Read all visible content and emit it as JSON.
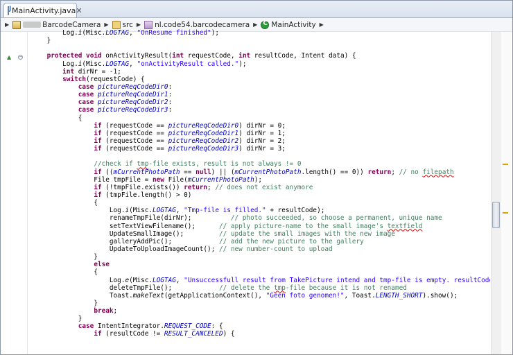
{
  "tab": {
    "title": "MainActivity.java",
    "close": "✕"
  },
  "breadcrumb": [
    {
      "label": "BarcodeCamera",
      "icon": "project-icon"
    },
    {
      "label": "src",
      "icon": "source-folder-icon"
    },
    {
      "label": "nl.code54.barcodecamera",
      "icon": "package-icon"
    },
    {
      "label": "MainActivity",
      "icon": "class-icon"
    }
  ],
  "code_lines": [
    [
      [
        "",
        "        Log."
      ],
      [
        "i",
        "i"
      ],
      [
        "",
        "(Misc."
      ],
      [
        "sf",
        "LOGTAG"
      ],
      [
        "",
        ", "
      ],
      [
        "s",
        "\"OnResume finished\""
      ],
      [
        "",
        ");"
      ]
    ],
    [
      [
        "",
        "    }"
      ]
    ],
    [
      [
        "",
        ""
      ]
    ],
    [
      [
        "",
        "    "
      ],
      [
        "k",
        "protected"
      ],
      [
        "",
        " "
      ],
      [
        "k",
        "void"
      ],
      [
        "",
        " onActivityResult("
      ],
      [
        "k",
        "int"
      ],
      [
        "",
        " requestCode, "
      ],
      [
        "k",
        "int"
      ],
      [
        "",
        " resultCode, Intent data) {"
      ]
    ],
    [
      [
        "",
        "        Log."
      ],
      [
        "i",
        "i"
      ],
      [
        "",
        "(Misc."
      ],
      [
        "sf",
        "LOGTAG"
      ],
      [
        "",
        ", "
      ],
      [
        "s",
        "\"onActivityResult called.\""
      ],
      [
        "",
        ");"
      ]
    ],
    [
      [
        "",
        "        "
      ],
      [
        "k",
        "int"
      ],
      [
        "",
        " dirNr = -1;"
      ]
    ],
    [
      [
        "",
        "        "
      ],
      [
        "k",
        "switch"
      ],
      [
        "",
        "(requestCode) {"
      ]
    ],
    [
      [
        "",
        "            "
      ],
      [
        "k",
        "case"
      ],
      [
        "",
        " "
      ],
      [
        "f",
        "pictureReqCodeDir0"
      ],
      [
        "",
        ":"
      ]
    ],
    [
      [
        "",
        "            "
      ],
      [
        "k",
        "case"
      ],
      [
        "",
        " "
      ],
      [
        "f",
        "pictureReqCodeDir1"
      ],
      [
        "",
        ":"
      ]
    ],
    [
      [
        "",
        "            "
      ],
      [
        "k",
        "case"
      ],
      [
        "",
        " "
      ],
      [
        "f",
        "pictureReqCodeDir2"
      ],
      [
        "",
        ":"
      ]
    ],
    [
      [
        "",
        "            "
      ],
      [
        "k",
        "case"
      ],
      [
        "",
        " "
      ],
      [
        "f",
        "pictureReqCodeDir3"
      ],
      [
        "",
        ":"
      ]
    ],
    [
      [
        "",
        "            {"
      ]
    ],
    [
      [
        "",
        "                "
      ],
      [
        "k",
        "if"
      ],
      [
        "",
        " (requestCode == "
      ],
      [
        "f",
        "pictureReqCodeDir0"
      ],
      [
        "",
        ") dirNr = 0;"
      ]
    ],
    [
      [
        "",
        "                "
      ],
      [
        "k",
        "if"
      ],
      [
        "",
        " (requestCode == "
      ],
      [
        "f",
        "pictureReqCodeDir1"
      ],
      [
        "",
        ") dirNr = 1;"
      ]
    ],
    [
      [
        "",
        "                "
      ],
      [
        "k",
        "if"
      ],
      [
        "",
        " (requestCode == "
      ],
      [
        "f",
        "pictureReqCodeDir2"
      ],
      [
        "",
        ") dirNr = 2;"
      ]
    ],
    [
      [
        "",
        "                "
      ],
      [
        "k",
        "if"
      ],
      [
        "",
        " (requestCode == "
      ],
      [
        "f",
        "pictureReqCodeDir3"
      ],
      [
        "",
        ") dirNr = 3;"
      ]
    ],
    [
      [
        "",
        ""
      ]
    ],
    [
      [
        "",
        "                "
      ],
      [
        "c",
        "//check if "
      ],
      [
        "cu",
        "tmp"
      ],
      [
        "c",
        "-file exists, result is not always != 0"
      ]
    ],
    [
      [
        "",
        "                "
      ],
      [
        "k",
        "if"
      ],
      [
        "",
        " (("
      ],
      [
        "f",
        "mCurrentPhotoPath"
      ],
      [
        "",
        " == "
      ],
      [
        "k",
        "null"
      ],
      [
        "",
        ") || ("
      ],
      [
        "f",
        "mCurrentPhotoPath"
      ],
      [
        "",
        ".length() == 0)) "
      ],
      [
        "k",
        "return"
      ],
      [
        "",
        "; "
      ],
      [
        "c",
        "// no "
      ],
      [
        "cu",
        "filepath"
      ]
    ],
    [
      [
        "",
        "                File tmpFile = "
      ],
      [
        "k",
        "new"
      ],
      [
        "",
        " File("
      ],
      [
        "f",
        "mCurrentPhotoPath"
      ],
      [
        "",
        ");"
      ]
    ],
    [
      [
        "",
        "                "
      ],
      [
        "k",
        "if"
      ],
      [
        "",
        " (!tmpFile.exists()) "
      ],
      [
        "k",
        "return"
      ],
      [
        "",
        "; "
      ],
      [
        "c",
        "// does not exist anymore"
      ]
    ],
    [
      [
        "",
        "                "
      ],
      [
        "k",
        "if"
      ],
      [
        "",
        " (tmpFile.length() > 0)"
      ]
    ],
    [
      [
        "",
        "                {"
      ]
    ],
    [
      [
        "",
        "                    Log."
      ],
      [
        "i",
        "i"
      ],
      [
        "",
        "(Misc."
      ],
      [
        "sf",
        "LOGTAG"
      ],
      [
        "",
        ", "
      ],
      [
        "s",
        "\"Tmp-file is filled.\""
      ],
      [
        "",
        " + resultCode);"
      ]
    ],
    [
      [
        "",
        "                    renameTmpFile(dirNr);          "
      ],
      [
        "c",
        "// photo succeeded, so choose a permanent, unique name"
      ]
    ],
    [
      [
        "",
        "                    setTextViewFilename();      "
      ],
      [
        "c",
        "// apply picture-name to the small image's "
      ],
      [
        "cu",
        "textfield"
      ]
    ],
    [
      [
        "",
        "                    UpdateSmallImage();         "
      ],
      [
        "c",
        "// update the small images with the new image"
      ]
    ],
    [
      [
        "",
        "                    galleryAddPic();            "
      ],
      [
        "c",
        "// add the new picture to the gallery"
      ]
    ],
    [
      [
        "",
        "                    UpdateToUploadImageCount(); "
      ],
      [
        "c",
        "// new number-count to upload"
      ]
    ],
    [
      [
        "",
        "                }"
      ]
    ],
    [
      [
        "",
        "                "
      ],
      [
        "k",
        "else"
      ]
    ],
    [
      [
        "",
        "                {"
      ]
    ],
    [
      [
        "",
        "                    Log."
      ],
      [
        "i",
        "e"
      ],
      [
        "",
        "(Misc."
      ],
      [
        "sf",
        "LOGTAG"
      ],
      [
        "",
        ", "
      ],
      [
        "s",
        "\"Unsuccessfull result from TakePicture intend and tmp-file is empty. resultCode: \""
      ],
      [
        "",
        " + result"
      ]
    ],
    [
      [
        "",
        "                    deleteTmpFile();            "
      ],
      [
        "c",
        "// delete the "
      ],
      [
        "cu",
        "tmp"
      ],
      [
        "c",
        "-file because it is not renamed"
      ]
    ],
    [
      [
        "",
        "                    Toast."
      ],
      [
        "i",
        "makeText"
      ],
      [
        "",
        "(getApplicationContext(), "
      ],
      [
        "s",
        "\"Geen foto genomen!\""
      ],
      [
        "",
        ", Toast."
      ],
      [
        "sf",
        "LENGTH_SHORT"
      ],
      [
        "",
        ").show();"
      ]
    ],
    [
      [
        "",
        "                }"
      ]
    ],
    [
      [
        "",
        "                "
      ],
      [
        "k",
        "break"
      ],
      [
        "",
        ";"
      ]
    ],
    [
      [
        "",
        "            }"
      ]
    ],
    [
      [
        "",
        "            "
      ],
      [
        "k",
        "case"
      ],
      [
        "",
        " IntentIntegrator."
      ],
      [
        "sf",
        "REQUEST_CODE"
      ],
      [
        "",
        ": {"
      ]
    ],
    [
      [
        "",
        "                "
      ],
      [
        "k",
        "if"
      ],
      [
        "",
        " (resultCode != "
      ],
      [
        "sf",
        "RESULT_CANCELED"
      ],
      [
        "",
        ") {"
      ]
    ]
  ]
}
